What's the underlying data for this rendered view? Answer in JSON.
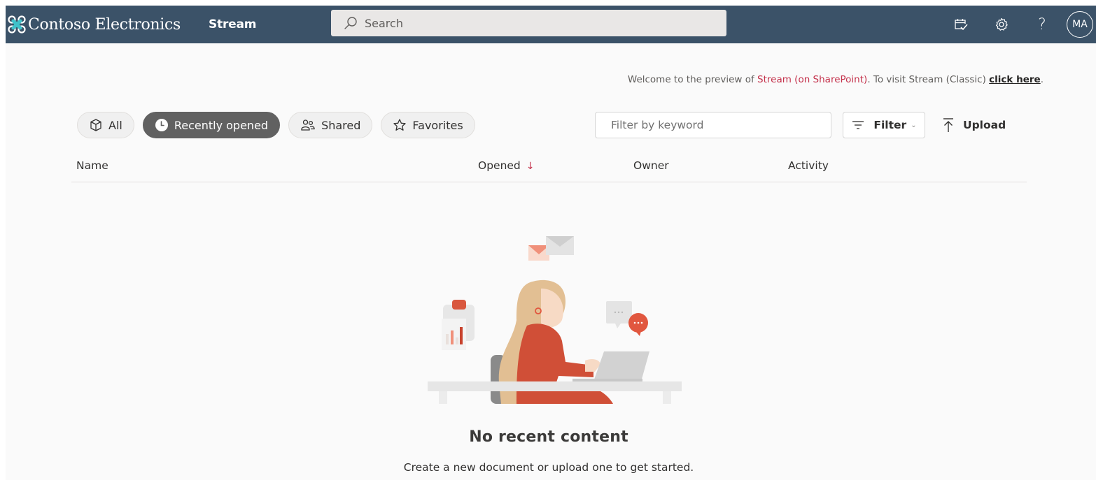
{
  "header": {
    "brand_name": "Contoso Electronics",
    "app_name": "Stream",
    "search_placeholder": "Search",
    "icons": [
      "calendar-check-icon",
      "gear-icon",
      "help-icon"
    ],
    "help_glyph": "?",
    "avatar_initials": "MA",
    "bg_color": "#3b5268",
    "logo_color": "#3fc1c9"
  },
  "welcome": {
    "prefix": "Welcome to the preview of ",
    "highlight": "Stream (on SharePoint)",
    "middle": ". To visit Stream (Classic) ",
    "link": "click here",
    "suffix": ".",
    "highlight_color": "#c4314b"
  },
  "pills": [
    {
      "label": "All",
      "icon": "cube-icon",
      "active": false
    },
    {
      "label": "Recently opened",
      "icon": "clock-icon",
      "active": true
    },
    {
      "label": "Shared",
      "icon": "people-icon",
      "active": false
    },
    {
      "label": "Favorites",
      "icon": "star-icon",
      "active": false
    }
  ],
  "toolbar": {
    "filter_placeholder": "Filter by keyword",
    "filter_label": "Filter",
    "filter_chevron": "⌄",
    "upload_label": "Upload"
  },
  "columns": [
    {
      "label": "Name"
    },
    {
      "label": "Opened",
      "sorted": "descending",
      "sort_glyph": "↓"
    },
    {
      "label": "Owner"
    },
    {
      "label": "Activity"
    }
  ],
  "empty_state": {
    "title": "No recent content",
    "subtitle": "Create a new document or upload one to get started.",
    "illustration": "woman-at-laptop-illustration"
  }
}
